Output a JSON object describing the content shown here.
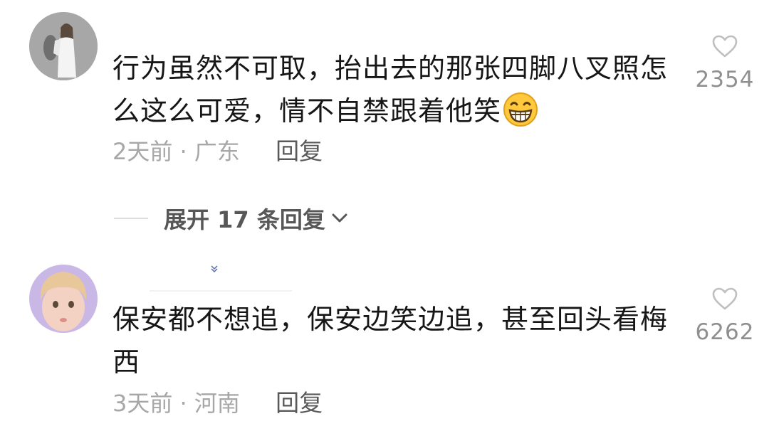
{
  "comments": [
    {
      "avatar": "woman-in-white-dress-photo",
      "text": "行为虽然不可取，抬出去的那张四脚八叉照怎么这么可爱，情不自禁跟着他笑",
      "emoji": "grinning-face-emoji",
      "time": "2天前",
      "separator": "·",
      "location": "广东",
      "reply_label": "回复",
      "like_count": "2354",
      "replies": {
        "label": "展开 17 条回复"
      }
    },
    {
      "avatar": "blond-child-photo",
      "text": "保安都不想追，保安边笑边追，甚至回头看梅西",
      "time": "3天前",
      "separator": "·",
      "location": "河南",
      "reply_label": "回复",
      "like_count": "6262"
    }
  ],
  "colors": {
    "text": "#161616",
    "meta": "#a7a7a7",
    "reply": "#595959",
    "like": "#bfbfbf",
    "emoji_face": "#ffc83d"
  }
}
